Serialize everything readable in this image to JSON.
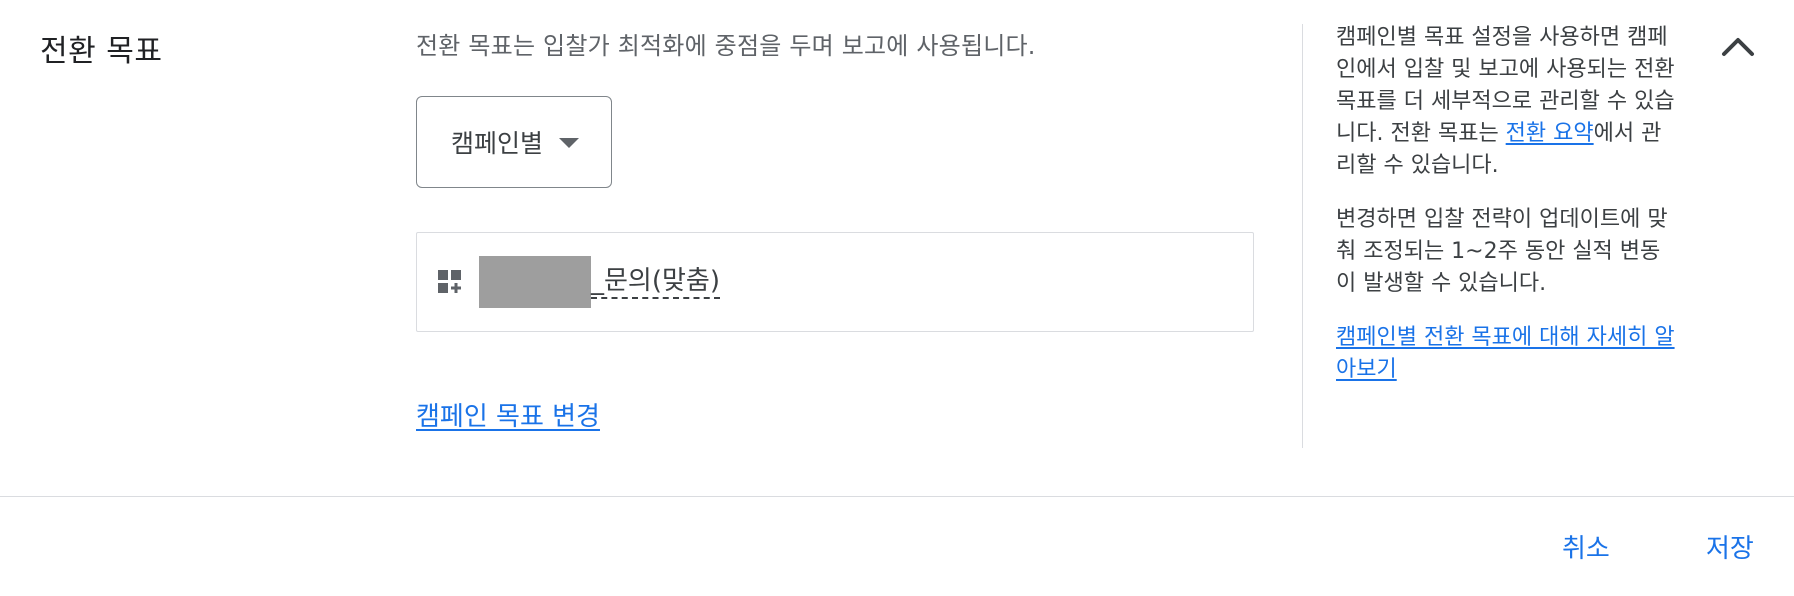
{
  "section": {
    "title": "전환 목표",
    "description": "전환 목표는 입찰가 최적화에 중점을 두며 보고에 사용됩니다."
  },
  "dropdown": {
    "selected": "캠페인별"
  },
  "goal": {
    "name": "_문의(맞춤)",
    "icon": "add-grid-icon"
  },
  "change_link": "캠페인 목표 변경",
  "help": {
    "para1": "캠페인별 목표 설정을 사용하면 캠페인에서 입찰 및 보고에 사용되는 전환 목표를 더 세부적으로 관리할 수 있습니다.",
    "para1b_prefix": "전환 목표는 ",
    "para1b_link": "전환 요약",
    "para1b_suffix": "에서 관리할 수 있습니다.",
    "para2": "변경하면 입찰 전략이 업데이트에 맞춰 조정되는 1~2주 동안 실적 변동이 발생할 수 있습니다.",
    "learn_more": "캠페인별 전환 목표에 대해 자세히 알아보기"
  },
  "actions": {
    "cancel": "취소",
    "save": "저장"
  },
  "colors": {
    "accent": "#1a73e8",
    "text": "#202124",
    "muted": "#5f6368",
    "border": "#dadce0"
  }
}
